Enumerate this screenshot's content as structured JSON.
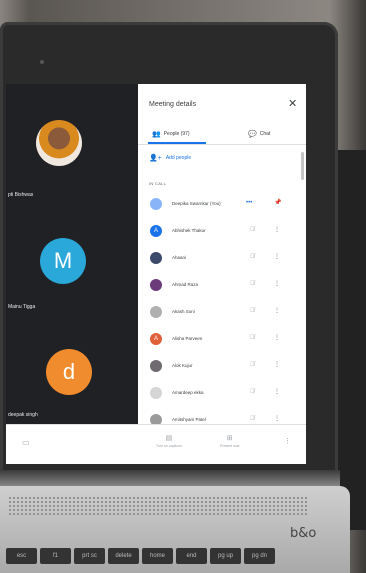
{
  "stage": {
    "tiles": [
      {
        "name": "pti Bishwas",
        "type": "photo"
      },
      {
        "name": "Mainu Tigga",
        "letter": "M",
        "color": "#29a8d9"
      },
      {
        "name": "deepak singh",
        "letter": "d",
        "color": "#f08c2d"
      }
    ]
  },
  "panel": {
    "title": "Meeting details",
    "tabs": [
      {
        "label": "People (97)",
        "icon": "people-icon",
        "active": true
      },
      {
        "label": "Chat",
        "icon": "chat-icon",
        "active": false
      }
    ],
    "add_people": "Add people",
    "section_label": "IN CALL",
    "people": [
      {
        "name": "Deepika Swarnkar (You)",
        "initial": "",
        "color": "#8ab4f8",
        "self": true
      },
      {
        "name": "Abhishek Thakur",
        "initial": "A",
        "color": "#1a73e8"
      },
      {
        "name": "Ahaani",
        "initial": "",
        "color": "#3b4a6b"
      },
      {
        "name": "Ahmad Raza",
        "initial": "",
        "color": "#6b3b7a"
      },
      {
        "name": "Akash Soni",
        "initial": "",
        "color": "#b0b0b0"
      },
      {
        "name": "Alisha Parveen",
        "initial": "A",
        "color": "#e0603a"
      },
      {
        "name": "Alok Kujur",
        "initial": "",
        "color": "#6f6a70"
      },
      {
        "name": "Amardeep ekka",
        "initial": "",
        "color": "#d5d5d5"
      },
      {
        "name": "Amitshyam Patel",
        "initial": "",
        "color": "#9a9a9a"
      }
    ]
  },
  "controls": {
    "captions": "Turn on captions",
    "present": "Present now"
  },
  "laptop": {
    "brand": "b&o",
    "keys": [
      "esc",
      "f1",
      "prt sc",
      "delete",
      "home",
      "end",
      "pg up",
      "pg dn"
    ]
  },
  "colors": {
    "accent": "#1a73e8",
    "stage_bg": "#202124"
  }
}
